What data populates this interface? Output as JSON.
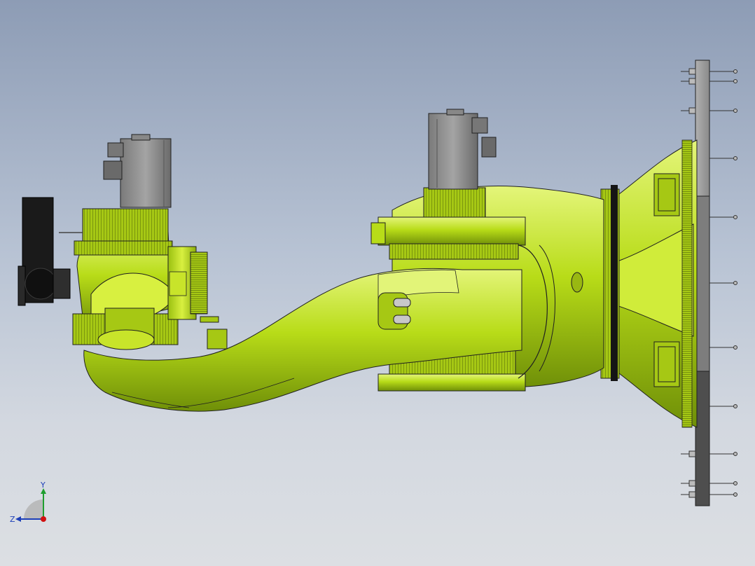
{
  "triad": {
    "y_label": "Y",
    "z_label": "Z",
    "colors": {
      "y_axis": "#1f9e2f",
      "z_axis": "#1d3fb8",
      "x_axis": "#d01010"
    }
  },
  "model": {
    "colors": {
      "body": "#b8dc18",
      "body_dark": "#7a9a0a",
      "body_highlight": "#e4f57a",
      "motor": "#8f8f8f",
      "motor_dark": "#6e6e6e",
      "base_plate": "#9a9a9a",
      "base_plate_dark": "#555555",
      "camera": "#1a1a1a",
      "edge": "#202020"
    }
  }
}
